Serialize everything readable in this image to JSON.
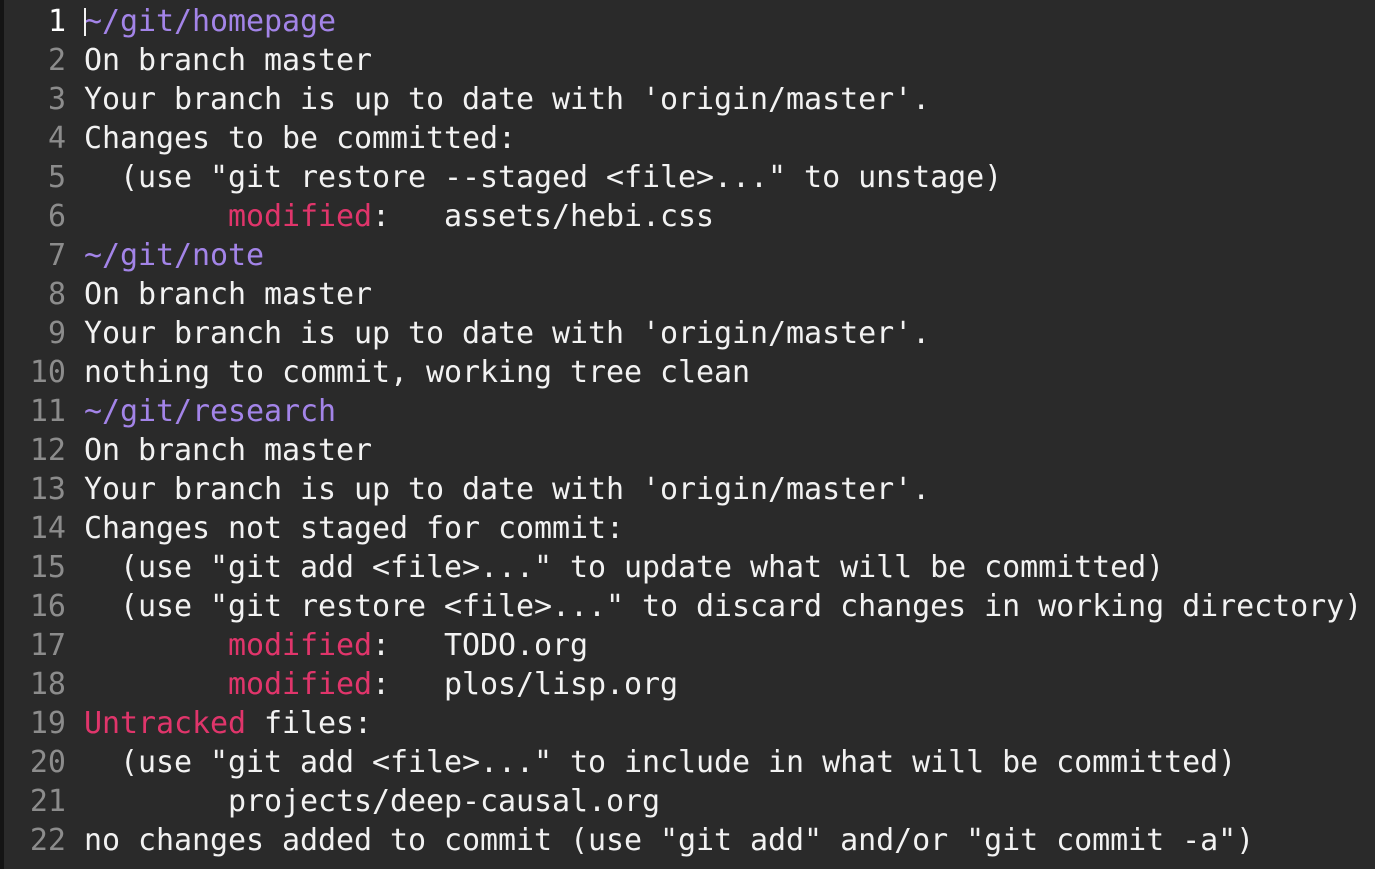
{
  "editor": {
    "colors": {
      "background": "#2a2a2a",
      "text": "#f2f2f2",
      "line_number": "#8c8c8c",
      "path": "#a384e8",
      "highlight_red": "#e0356b"
    },
    "current_line": 1,
    "lines": [
      {
        "num": "1",
        "segments": [
          {
            "text": "~/git/homepage",
            "style": "path"
          }
        ]
      },
      {
        "num": "2",
        "segments": [
          {
            "text": "On branch master",
            "style": "plain"
          }
        ]
      },
      {
        "num": "3",
        "segments": [
          {
            "text": "Your branch is up to date with 'origin/master'.",
            "style": "plain"
          }
        ]
      },
      {
        "num": "4",
        "segments": [
          {
            "text": "Changes to be committed:",
            "style": "plain"
          }
        ]
      },
      {
        "num": "5",
        "segments": [
          {
            "text": "  (use \"git restore --staged <file>...\" to unstage)",
            "style": "plain"
          }
        ]
      },
      {
        "num": "6",
        "segments": [
          {
            "text": "        ",
            "style": "plain"
          },
          {
            "text": "modified",
            "style": "red"
          },
          {
            "text": ":   assets/hebi.css",
            "style": "plain"
          }
        ]
      },
      {
        "num": "7",
        "segments": [
          {
            "text": "~/git/note",
            "style": "path"
          }
        ]
      },
      {
        "num": "8",
        "segments": [
          {
            "text": "On branch master",
            "style": "plain"
          }
        ]
      },
      {
        "num": "9",
        "segments": [
          {
            "text": "Your branch is up to date with 'origin/master'.",
            "style": "plain"
          }
        ]
      },
      {
        "num": "10",
        "segments": [
          {
            "text": "nothing to commit, working tree clean",
            "style": "plain"
          }
        ]
      },
      {
        "num": "11",
        "segments": [
          {
            "text": "~/git/research",
            "style": "path"
          }
        ]
      },
      {
        "num": "12",
        "segments": [
          {
            "text": "On branch master",
            "style": "plain"
          }
        ]
      },
      {
        "num": "13",
        "segments": [
          {
            "text": "Your branch is up to date with 'origin/master'.",
            "style": "plain"
          }
        ]
      },
      {
        "num": "14",
        "segments": [
          {
            "text": "Changes not staged for commit:",
            "style": "plain"
          }
        ]
      },
      {
        "num": "15",
        "segments": [
          {
            "text": "  (use \"git add <file>...\" to update what will be committed)",
            "style": "plain"
          }
        ]
      },
      {
        "num": "16",
        "segments": [
          {
            "text": "  (use \"git restore <file>...\" to discard changes in working directory)",
            "style": "plain"
          }
        ]
      },
      {
        "num": "17",
        "segments": [
          {
            "text": "        ",
            "style": "plain"
          },
          {
            "text": "modified",
            "style": "red"
          },
          {
            "text": ":   TODO.org",
            "style": "plain"
          }
        ]
      },
      {
        "num": "18",
        "segments": [
          {
            "text": "        ",
            "style": "plain"
          },
          {
            "text": "modified",
            "style": "red"
          },
          {
            "text": ":   plos/lisp.org",
            "style": "plain"
          }
        ]
      },
      {
        "num": "19",
        "segments": [
          {
            "text": "Untracked",
            "style": "red"
          },
          {
            "text": " files:",
            "style": "plain"
          }
        ]
      },
      {
        "num": "20",
        "segments": [
          {
            "text": "  (use \"git add <file>...\" to include in what will be committed)",
            "style": "plain"
          }
        ]
      },
      {
        "num": "21",
        "segments": [
          {
            "text": "        projects/deep-causal.org",
            "style": "plain"
          }
        ]
      },
      {
        "num": "22",
        "segments": [
          {
            "text": "no changes added to commit (use \"git add\" and/or \"git commit -a\")",
            "style": "plain"
          }
        ]
      }
    ]
  }
}
